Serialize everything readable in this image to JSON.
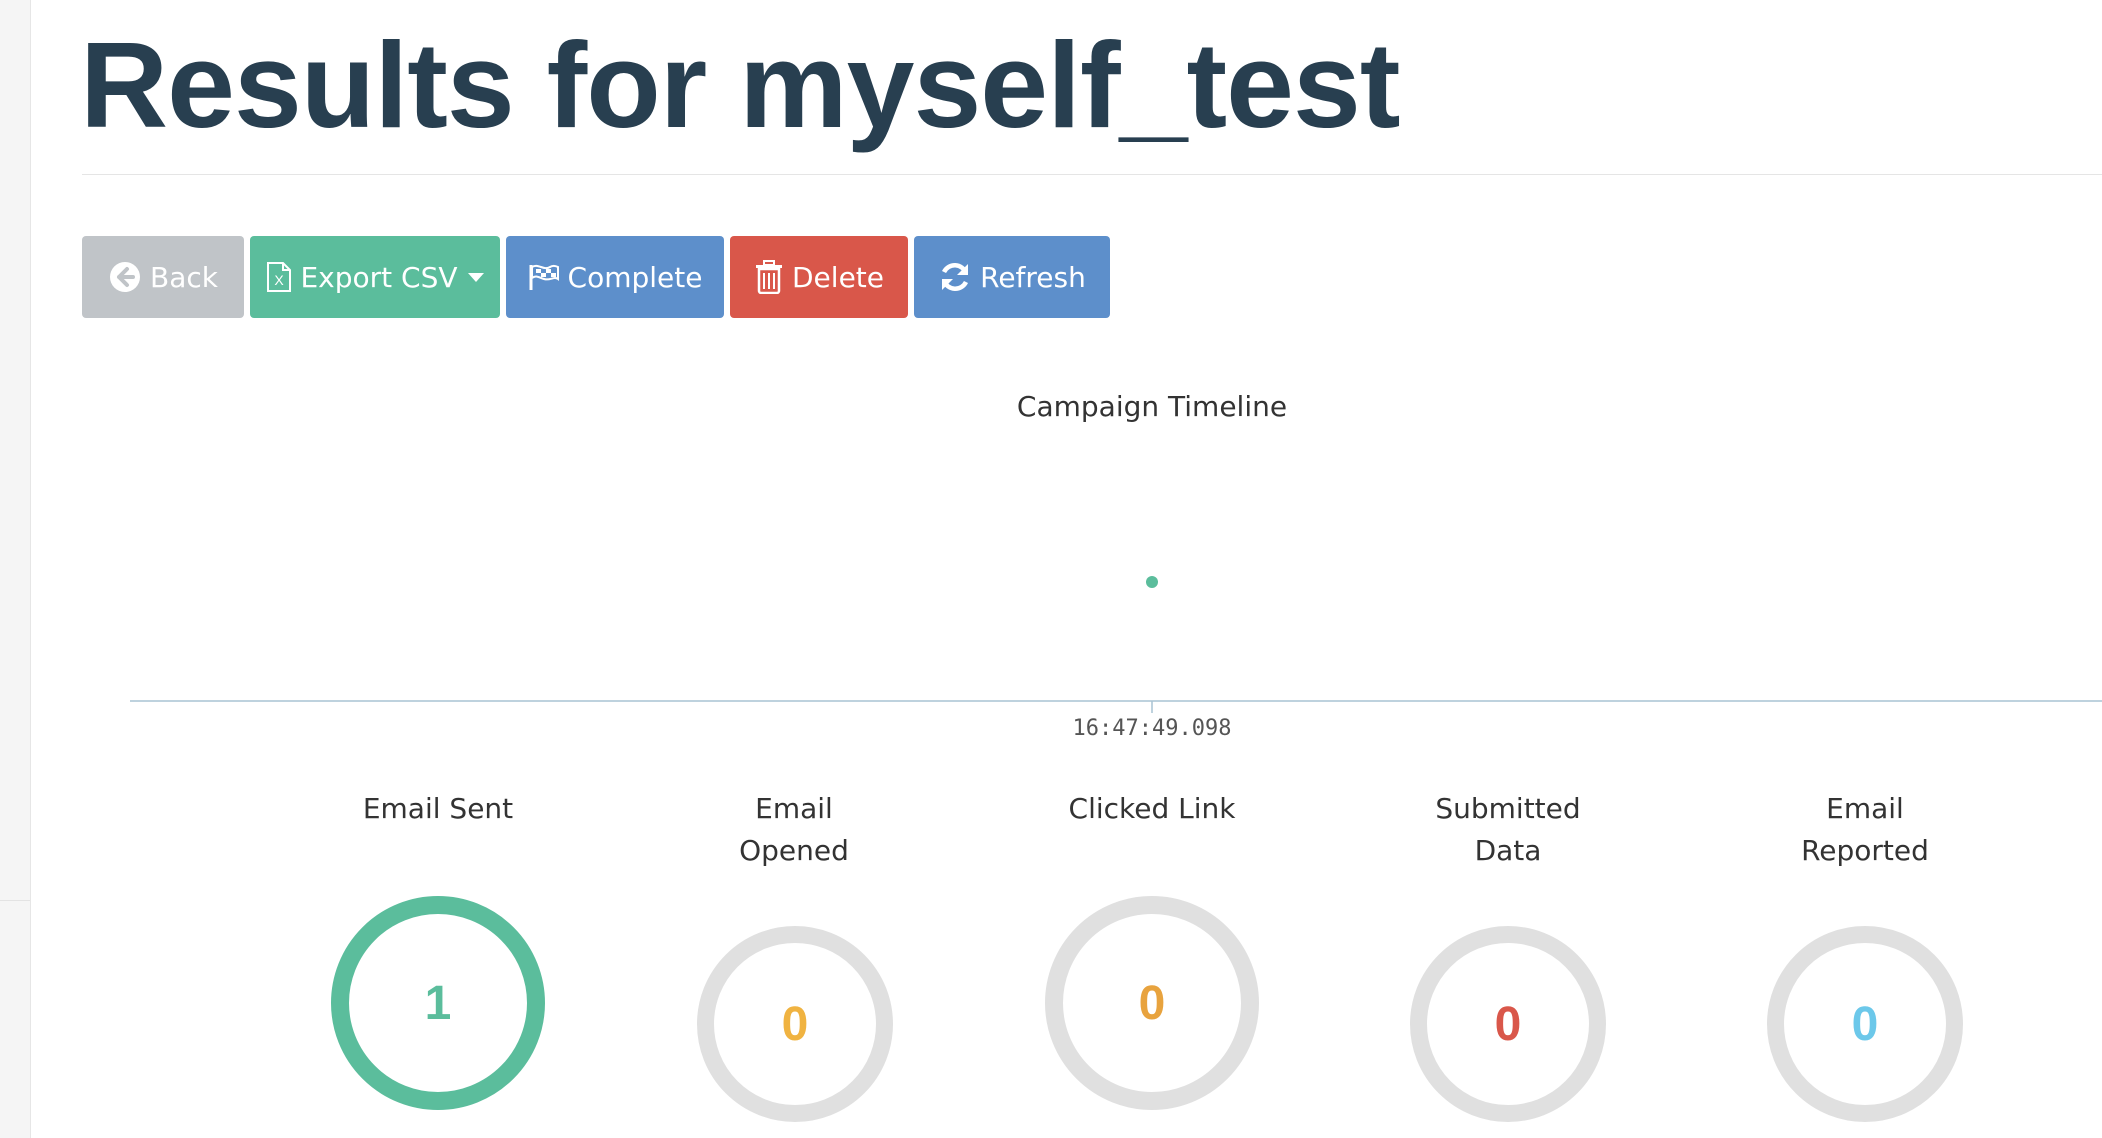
{
  "page": {
    "title": "Results for myself_test"
  },
  "toolbar": {
    "back_label": "Back",
    "export_label": "Export CSV",
    "complete_label": "Complete",
    "delete_label": "Delete",
    "refresh_label": "Refresh"
  },
  "timeline": {
    "title": "Campaign Timeline",
    "event_time_label": "16:47:49.098",
    "point_color": "#5bbd9c"
  },
  "stats": [
    {
      "label": "Email Sent",
      "value": "1",
      "color": "#5bbd9c",
      "ring": "filled"
    },
    {
      "label": "Email Opened",
      "value": "0",
      "color": "#f0b341",
      "ring": "empty"
    },
    {
      "label": "Clicked Link",
      "value": "0",
      "color": "#e8a33e",
      "ring": "empty"
    },
    {
      "label": "Submitted Data",
      "value": "0",
      "color": "#d9574a",
      "ring": "empty"
    },
    {
      "label": "Email Reported",
      "value": "0",
      "color": "#6cc8ea",
      "ring": "empty"
    }
  ],
  "icons": {
    "back": "circle-arrow-left-icon",
    "export": "excel-file-icon",
    "complete": "flag-checkered-icon",
    "delete": "trash-icon",
    "refresh": "refresh-icon"
  }
}
